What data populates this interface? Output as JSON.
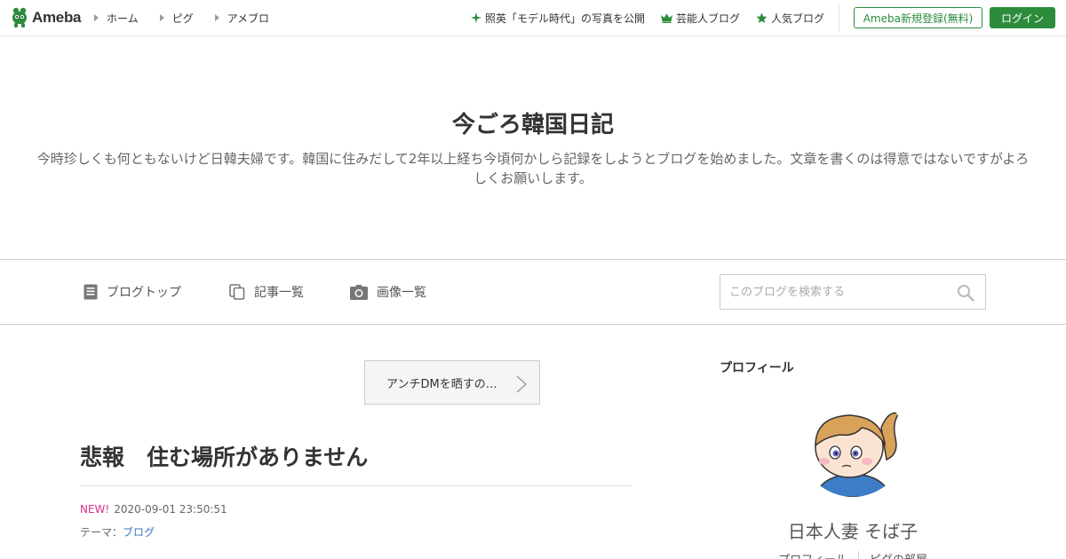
{
  "topbar": {
    "logo_text": "Ameba",
    "nav": [
      {
        "label": "ホーム"
      },
      {
        "label": "ピグ"
      },
      {
        "label": "アメブロ"
      }
    ],
    "links": [
      {
        "label": "照英「モデル時代」の写真を公開",
        "icon": "sparkle-icon"
      },
      {
        "label": "芸能人ブログ",
        "icon": "crown-icon"
      },
      {
        "label": "人気ブログ",
        "icon": "star-icon"
      }
    ],
    "register_label": "Ameba新規登録(無料)",
    "login_label": "ログイン",
    "colors": {
      "brand": "#2d8c3c"
    }
  },
  "header": {
    "title": "今ごろ韓国日記",
    "description": "今時珍しくも何ともないけど日韓夫婦です。韓国に住みだして2年以上経ち今頃何かしら記録をしようとブログを始めました。文章を書くのは得意ではないですがよろしくお願いします。"
  },
  "blognav": {
    "items": [
      {
        "label": "ブログトップ",
        "icon": "document-icon"
      },
      {
        "label": "記事一覧",
        "icon": "copy-icon"
      },
      {
        "label": "画像一覧",
        "icon": "camera-icon"
      }
    ],
    "search_placeholder": "このブログを検索する"
  },
  "article": {
    "prev_label": "アンチDMを晒すの…",
    "title": "悲報　住む場所がありません",
    "new_label": "NEW!",
    "datetime": "2020-09-01 23:50:51",
    "theme_prefix": "テーマ：",
    "theme": "ブログ",
    "colors": {
      "new": "#d9318d",
      "link": "#3a75c4"
    }
  },
  "sidebar": {
    "heading": "プロフィール",
    "name": "日本人妻 そば子",
    "links": [
      {
        "label": "プロフィール"
      },
      {
        "label": "ピグの部屋"
      }
    ]
  }
}
